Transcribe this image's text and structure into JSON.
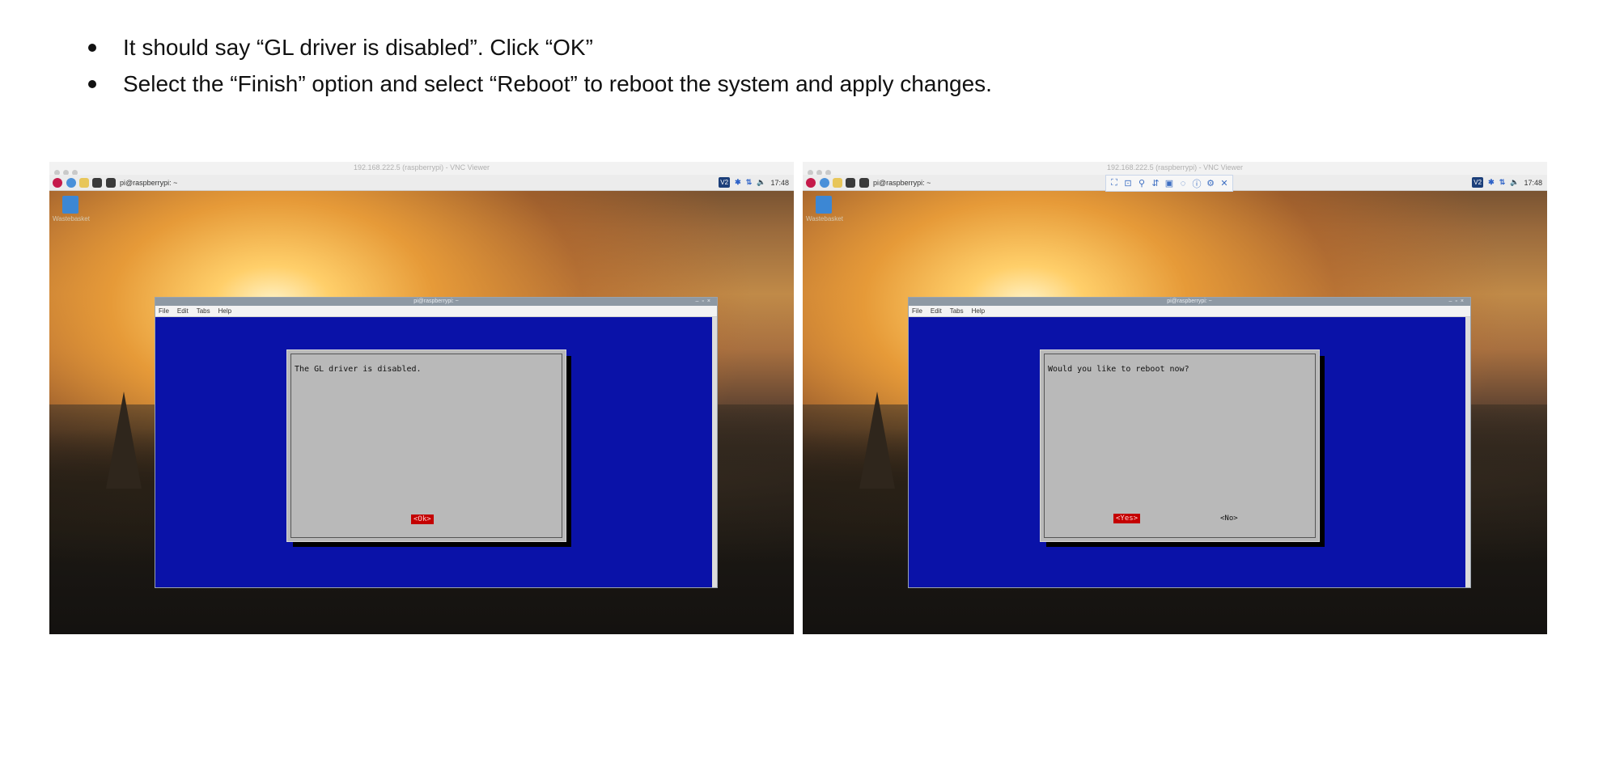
{
  "instructions": [
    "It should say “GL driver is disabled”. Click “OK”",
    "Select the “Finish” option and select “Reboot” to reboot the system and apply changes."
  ],
  "left_screenshot": {
    "vnc_window_title": "192.168.222.5 (raspberrypi) - VNC Viewer",
    "taskbar_terminal_label": "pi@raspberrypi: ~",
    "clock": "17:48",
    "trash_label": "Wastebasket",
    "terminal_title": "pi@raspberrypi: ~",
    "menu": [
      "File",
      "Edit",
      "Tabs",
      "Help"
    ],
    "dialog_message": "The GL driver is disabled.",
    "ok_button": "<Ok>"
  },
  "right_screenshot": {
    "vnc_window_title": "192.168.222.5 (raspberrypi) - VNC Viewer",
    "taskbar_terminal_label": "pi@raspberrypi: ~",
    "clock": "17:48",
    "trash_label": "Wastebasket",
    "terminal_title": "pi@raspberrypi: ~",
    "menu": [
      "File",
      "Edit",
      "Tabs",
      "Help"
    ],
    "dialog_message": "Would you like to reboot now?",
    "yes_button": "<Yes>",
    "no_button": "<No>"
  },
  "colors": {
    "terminal_background": "#0a12a8",
    "dialog_background": "#b9b9b9",
    "selected_button": "#c40000"
  }
}
